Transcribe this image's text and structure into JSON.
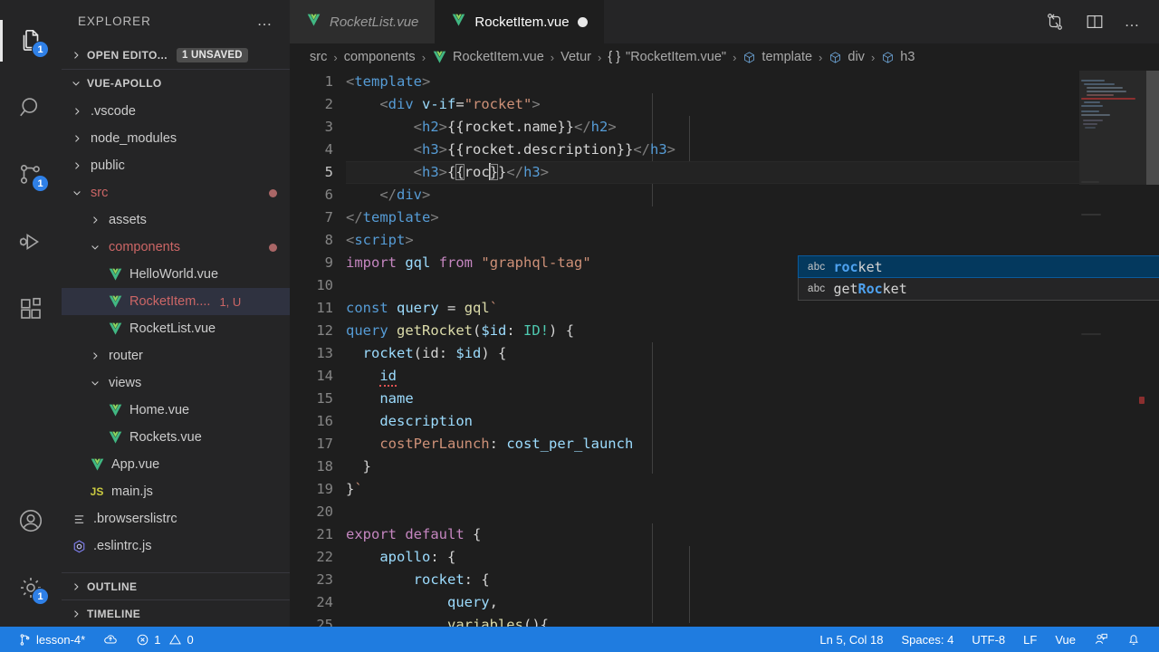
{
  "activity_bar": {
    "items": [
      {
        "name": "explorer",
        "icon": "files-icon",
        "badge": "1",
        "active": true
      },
      {
        "name": "search",
        "icon": "search-icon",
        "badge": null,
        "active": false
      },
      {
        "name": "source-control",
        "icon": "source-control-icon",
        "badge": "1",
        "active": false
      },
      {
        "name": "run-and-debug",
        "icon": "run-debug-icon",
        "badge": null,
        "active": false
      },
      {
        "name": "extensions",
        "icon": "extensions-icon",
        "badge": null,
        "active": false
      }
    ],
    "bottom_items": [
      {
        "name": "accounts",
        "icon": "account-icon",
        "badge": null
      },
      {
        "name": "manage",
        "icon": "gear-icon",
        "badge": "1"
      }
    ]
  },
  "sidebar": {
    "title": "EXPLORER",
    "more_actions": "…",
    "open_editors": {
      "label": "OPEN EDITO...",
      "badge": "1 UNSAVED",
      "expanded": false
    },
    "workspace": {
      "label": "VUE-APOLLO",
      "expanded": true
    },
    "tree": [
      {
        "label": ".vscode",
        "depth": 1,
        "type": "folder",
        "expanded": false
      },
      {
        "label": "node_modules",
        "depth": 1,
        "type": "folder",
        "expanded": false
      },
      {
        "label": "public",
        "depth": 1,
        "type": "folder",
        "expanded": false
      },
      {
        "label": "src",
        "depth": 1,
        "type": "folder",
        "expanded": true,
        "modified": true
      },
      {
        "label": "assets",
        "depth": 2,
        "type": "folder",
        "expanded": false
      },
      {
        "label": "components",
        "depth": 2,
        "type": "folder",
        "expanded": true,
        "modified": true
      },
      {
        "label": "HelloWorld.vue",
        "depth": 3,
        "type": "vue"
      },
      {
        "label": "RocketItem....",
        "depth": 3,
        "type": "vue",
        "badge": "1, U",
        "selected": true,
        "modified": true
      },
      {
        "label": "RocketList.vue",
        "depth": 3,
        "type": "vue"
      },
      {
        "label": "router",
        "depth": 2,
        "type": "folder",
        "expanded": false
      },
      {
        "label": "views",
        "depth": 2,
        "type": "folder",
        "expanded": true
      },
      {
        "label": "Home.vue",
        "depth": 3,
        "type": "vue"
      },
      {
        "label": "Rockets.vue",
        "depth": 3,
        "type": "vue"
      },
      {
        "label": "App.vue",
        "depth": 2,
        "type": "vue"
      },
      {
        "label": "main.js",
        "depth": 2,
        "type": "js"
      },
      {
        "label": ".browserslistrc",
        "depth": 1,
        "type": "config"
      },
      {
        "label": ".eslintrc.js",
        "depth": 1,
        "type": "eslint"
      }
    ],
    "outline": {
      "label": "OUTLINE",
      "expanded": false
    },
    "timeline": {
      "label": "TIMELINE",
      "expanded": false
    }
  },
  "tabs": [
    {
      "label": "RocketList.vue",
      "icon": "vue-icon",
      "active": false,
      "dirty": false
    },
    {
      "label": "RocketItem.vue",
      "icon": "vue-icon",
      "active": true,
      "dirty": true
    }
  ],
  "tab_actions": [
    {
      "name": "open-changes-icon",
      "title": "Open Changes"
    },
    {
      "name": "split-editor-icon",
      "title": "Split Editor"
    },
    {
      "name": "more-actions-icon",
      "title": "More Actions",
      "label": "…"
    }
  ],
  "breadcrumb": [
    {
      "label": "src",
      "icon": null
    },
    {
      "label": "components",
      "icon": null
    },
    {
      "label": "RocketItem.vue",
      "icon": "vue-icon"
    },
    {
      "label": "Vetur",
      "icon": null
    },
    {
      "label": "\"RocketItem.vue\"",
      "icon": "braces-icon"
    },
    {
      "label": "template",
      "icon": "symbol-icon"
    },
    {
      "label": "div",
      "icon": "symbol-icon"
    },
    {
      "label": "h3",
      "icon": "symbol-icon"
    }
  ],
  "editor": {
    "file": "RocketItem.vue",
    "first_line": 1,
    "cursor_line": 5,
    "lines": [
      {
        "n": 1,
        "text": "<template>"
      },
      {
        "n": 2,
        "text": "    <div v-if=\"rocket\">"
      },
      {
        "n": 3,
        "text": "        <h2>{{rocket.name}}</h2>"
      },
      {
        "n": 4,
        "text": "        <h3>{{rocket.description}}</h3>"
      },
      {
        "n": 5,
        "text": "        <h3>{{roc}}</h3>"
      },
      {
        "n": 6,
        "text": "    </div>"
      },
      {
        "n": 7,
        "text": "</template>"
      },
      {
        "n": 8,
        "text": "<script>"
      },
      {
        "n": 9,
        "text": "import gql from \"graphql-tag\""
      },
      {
        "n": 10,
        "text": ""
      },
      {
        "n": 11,
        "text": "const query = gql`"
      },
      {
        "n": 12,
        "text": "query getRocket($id: ID!) {"
      },
      {
        "n": 13,
        "text": "  rocket(id: $id) {"
      },
      {
        "n": 14,
        "text": "    id"
      },
      {
        "n": 15,
        "text": "    name"
      },
      {
        "n": 16,
        "text": "    description"
      },
      {
        "n": 17,
        "text": "    costPerLaunch: cost_per_launch"
      },
      {
        "n": 18,
        "text": "  }"
      },
      {
        "n": 19,
        "text": "}`"
      },
      {
        "n": 20,
        "text": ""
      },
      {
        "n": 21,
        "text": "export default {"
      },
      {
        "n": 22,
        "text": "    apollo: {"
      },
      {
        "n": 23,
        "text": "        rocket: {"
      },
      {
        "n": 24,
        "text": "            query,"
      },
      {
        "n": 25,
        "text": "            variables(){"
      }
    ]
  },
  "suggest_widget": {
    "visible": true,
    "typed_prefix": "roc",
    "items": [
      {
        "kind": "abc",
        "label": "rocket",
        "match_prefix": "roc",
        "match_rest": "ket",
        "selected": true
      },
      {
        "kind": "abc",
        "label": "getRocket",
        "match_head": "get",
        "match_prefix": "Roc",
        "match_rest": "ket",
        "selected": false
      }
    ]
  },
  "status_bar": {
    "branch": "lesson-4*",
    "branch_icon": "source-control-icon",
    "sync_icon": "cloud-upload-icon",
    "errors_icon": "error-icon",
    "errors": "1",
    "warnings_icon": "warning-icon",
    "warnings": "0",
    "position": "Ln 5, Col 18",
    "indentation": "Spaces: 4",
    "encoding": "UTF-8",
    "eol": "LF",
    "language": "Vue",
    "feedback_icon": "feedback-icon",
    "bell_icon": "bell-icon",
    "accent": "#1f7ce0"
  },
  "colors": {
    "editor_bg": "#1e1e1e",
    "sidebar_bg": "#252526",
    "activitybar_bg": "#252526",
    "tab_active_bg": "#1e1e1e",
    "tab_inactive_bg": "#2d2d2d",
    "status_bg": "#1f7ce0",
    "selection_blue": "#04395e",
    "badge_blue": "#2f80e7",
    "modified_red": "#cc6666",
    "vue_green": "#7ec24a"
  }
}
